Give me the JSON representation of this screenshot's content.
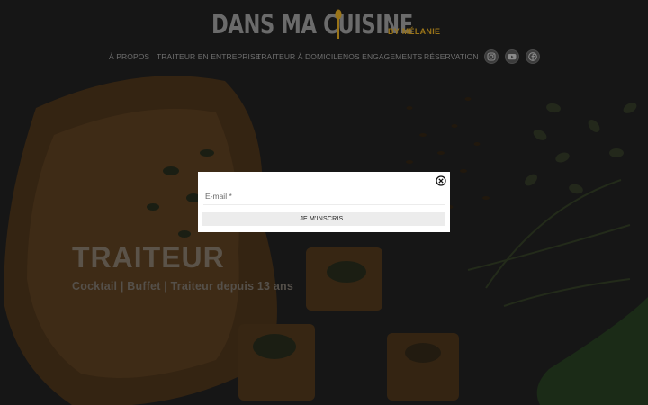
{
  "brand": {
    "name": "DANS MA CUISINE",
    "tagline": "BY MÉLANIE"
  },
  "nav": {
    "items": [
      {
        "label": "À PROPOS"
      },
      {
        "label": "TRAITEUR EN ENTREPRISE"
      },
      {
        "label": "TRAITEUR À DOMICILE"
      },
      {
        "label": "NOS ENGAGEMENTS"
      },
      {
        "label": "RÉSERVATION"
      }
    ],
    "social": [
      "instagram-icon",
      "youtube-icon",
      "facebook-icon"
    ]
  },
  "hero": {
    "title": "TRAITEUR",
    "subtitle": "Cocktail | Buffet | Traiteur depuis 13 ans"
  },
  "modal": {
    "email_placeholder": "E-mail *",
    "email_value": "",
    "submit_label": "JE M'INSCRIS !",
    "close_icon": "close-icon"
  },
  "colors": {
    "header_bg": "#161616",
    "accent": "#9a7418",
    "overlay": "#000000"
  }
}
